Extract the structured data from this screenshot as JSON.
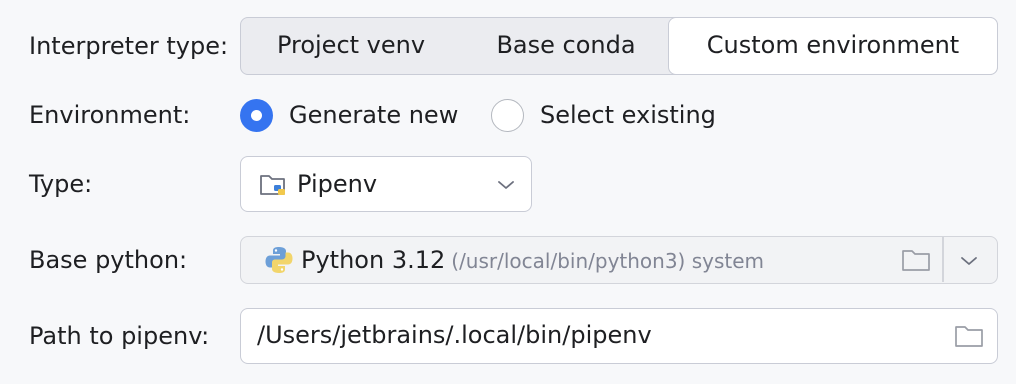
{
  "interpreter_type": {
    "label": "Interpreter type:",
    "options": [
      "Project venv",
      "Base conda",
      "Custom environment"
    ],
    "selected": "Custom environment"
  },
  "environment": {
    "label": "Environment:",
    "options": [
      "Generate new",
      "Select existing"
    ],
    "selected": "Generate new"
  },
  "type": {
    "label": "Type:",
    "value": "Pipenv",
    "icon": "pipenv-folder-icon"
  },
  "base_python": {
    "label": "Base python:",
    "version": "Python 3.12",
    "path": "(/usr/local/bin/python3) system",
    "icon": "python-icon"
  },
  "path_to_pipenv": {
    "label": "Path to pipenv:",
    "value": "/Users/jetbrains/.local/bin/pipenv"
  },
  "colors": {
    "accent": "#3574f0",
    "background": "#f7f8fa",
    "border": "#c9ccd6",
    "muted_text": "#818594"
  }
}
